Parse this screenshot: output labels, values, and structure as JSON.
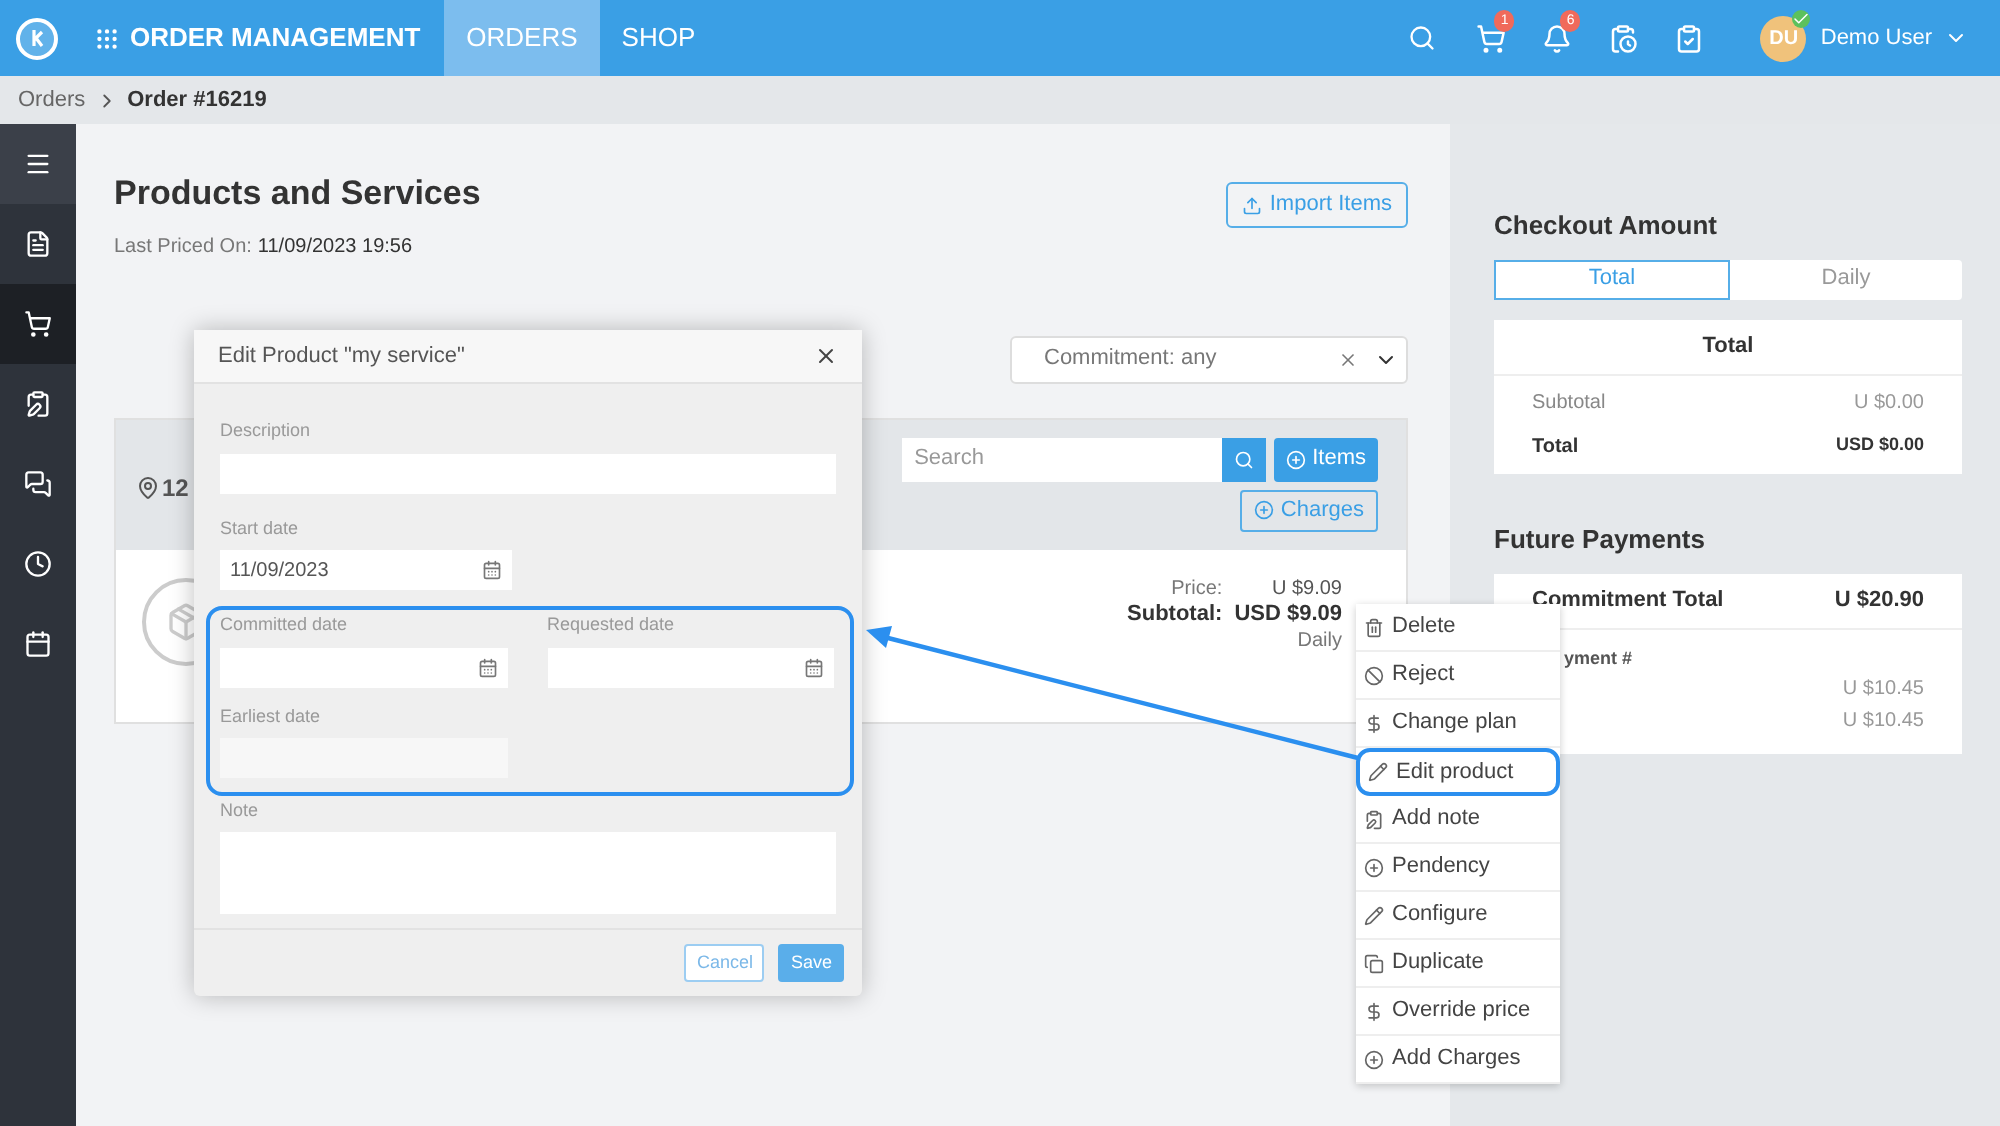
{
  "topbar": {
    "app_title": "ORDER MANAGEMENT",
    "tabs": [
      {
        "label": "ORDERS",
        "selected": true
      },
      {
        "label": "SHOP",
        "selected": false
      }
    ],
    "cart_badge": "1",
    "notification_badge": "6",
    "avatar": "DU",
    "user_name": "Demo User"
  },
  "breadcrumb": [
    "Orders",
    "Order #16219"
  ],
  "sidebar": {
    "items": [
      {
        "kind": "menu",
        "selected": false
      },
      {
        "kind": "invoice",
        "selected": false
      },
      {
        "kind": "cart",
        "selected": true
      },
      {
        "kind": "clipboard",
        "selected": false
      },
      {
        "kind": "chat",
        "selected": false
      },
      {
        "kind": "clock",
        "selected": false
      },
      {
        "kind": "calendar",
        "selected": false
      }
    ]
  },
  "products": {
    "title": "Products and Services",
    "last_priced_label": "Last Priced On:",
    "last_priced_value": "11/09/2023 19:56",
    "import_button": "Import Items",
    "commitment_filter": "Commitment: any",
    "card": {
      "location": "12",
      "search_placeholder": "Search",
      "items_button": "Items",
      "charges_button": "Charges",
      "price_label": "Price:",
      "price_value": "U $9.09",
      "subtotal_label": "Subtotal:",
      "subtotal_value": "USD $9.09",
      "period": "Daily"
    }
  },
  "modal": {
    "title": "Edit Product \"my service\"",
    "description_label": "Description",
    "start_date_label": "Start date",
    "start_date_value": "11/09/2023",
    "committed_date_label": "Committed date",
    "requested_date_label": "Requested date",
    "earliest_date_label": "Earliest date",
    "note_label": "Note",
    "cancel_button": "Cancel",
    "save_button": "Save"
  },
  "context_menu": [
    {
      "label": "Delete",
      "highlighted": false
    },
    {
      "label": "Reject",
      "highlighted": false
    },
    {
      "label": "Change plan",
      "highlighted": false
    },
    {
      "label": "Edit product",
      "highlighted": true
    },
    {
      "label": "Add note",
      "highlighted": false
    },
    {
      "label": "Pendency",
      "highlighted": false
    },
    {
      "label": "Configure",
      "highlighted": false
    },
    {
      "label": "Duplicate",
      "highlighted": false
    },
    {
      "label": "Override price",
      "highlighted": false
    },
    {
      "label": "Add Charges",
      "highlighted": false
    }
  ],
  "checkout": {
    "title": "Checkout Amount",
    "tabs": [
      {
        "label": "Total",
        "selected": true
      },
      {
        "label": "Daily",
        "selected": false
      }
    ],
    "card_title": "Total",
    "rows": [
      {
        "label": "Subtotal",
        "value": "U $0.00",
        "bold": false
      },
      {
        "label": "Total",
        "value": "USD $0.00",
        "bold": true
      }
    ]
  },
  "future_payments": {
    "title": "Future Payments",
    "commitment_label": "Commitment Total",
    "commitment_value": "U $20.90",
    "payment_label": "yment #",
    "payments": [
      "U $10.45",
      "U $10.45"
    ]
  }
}
